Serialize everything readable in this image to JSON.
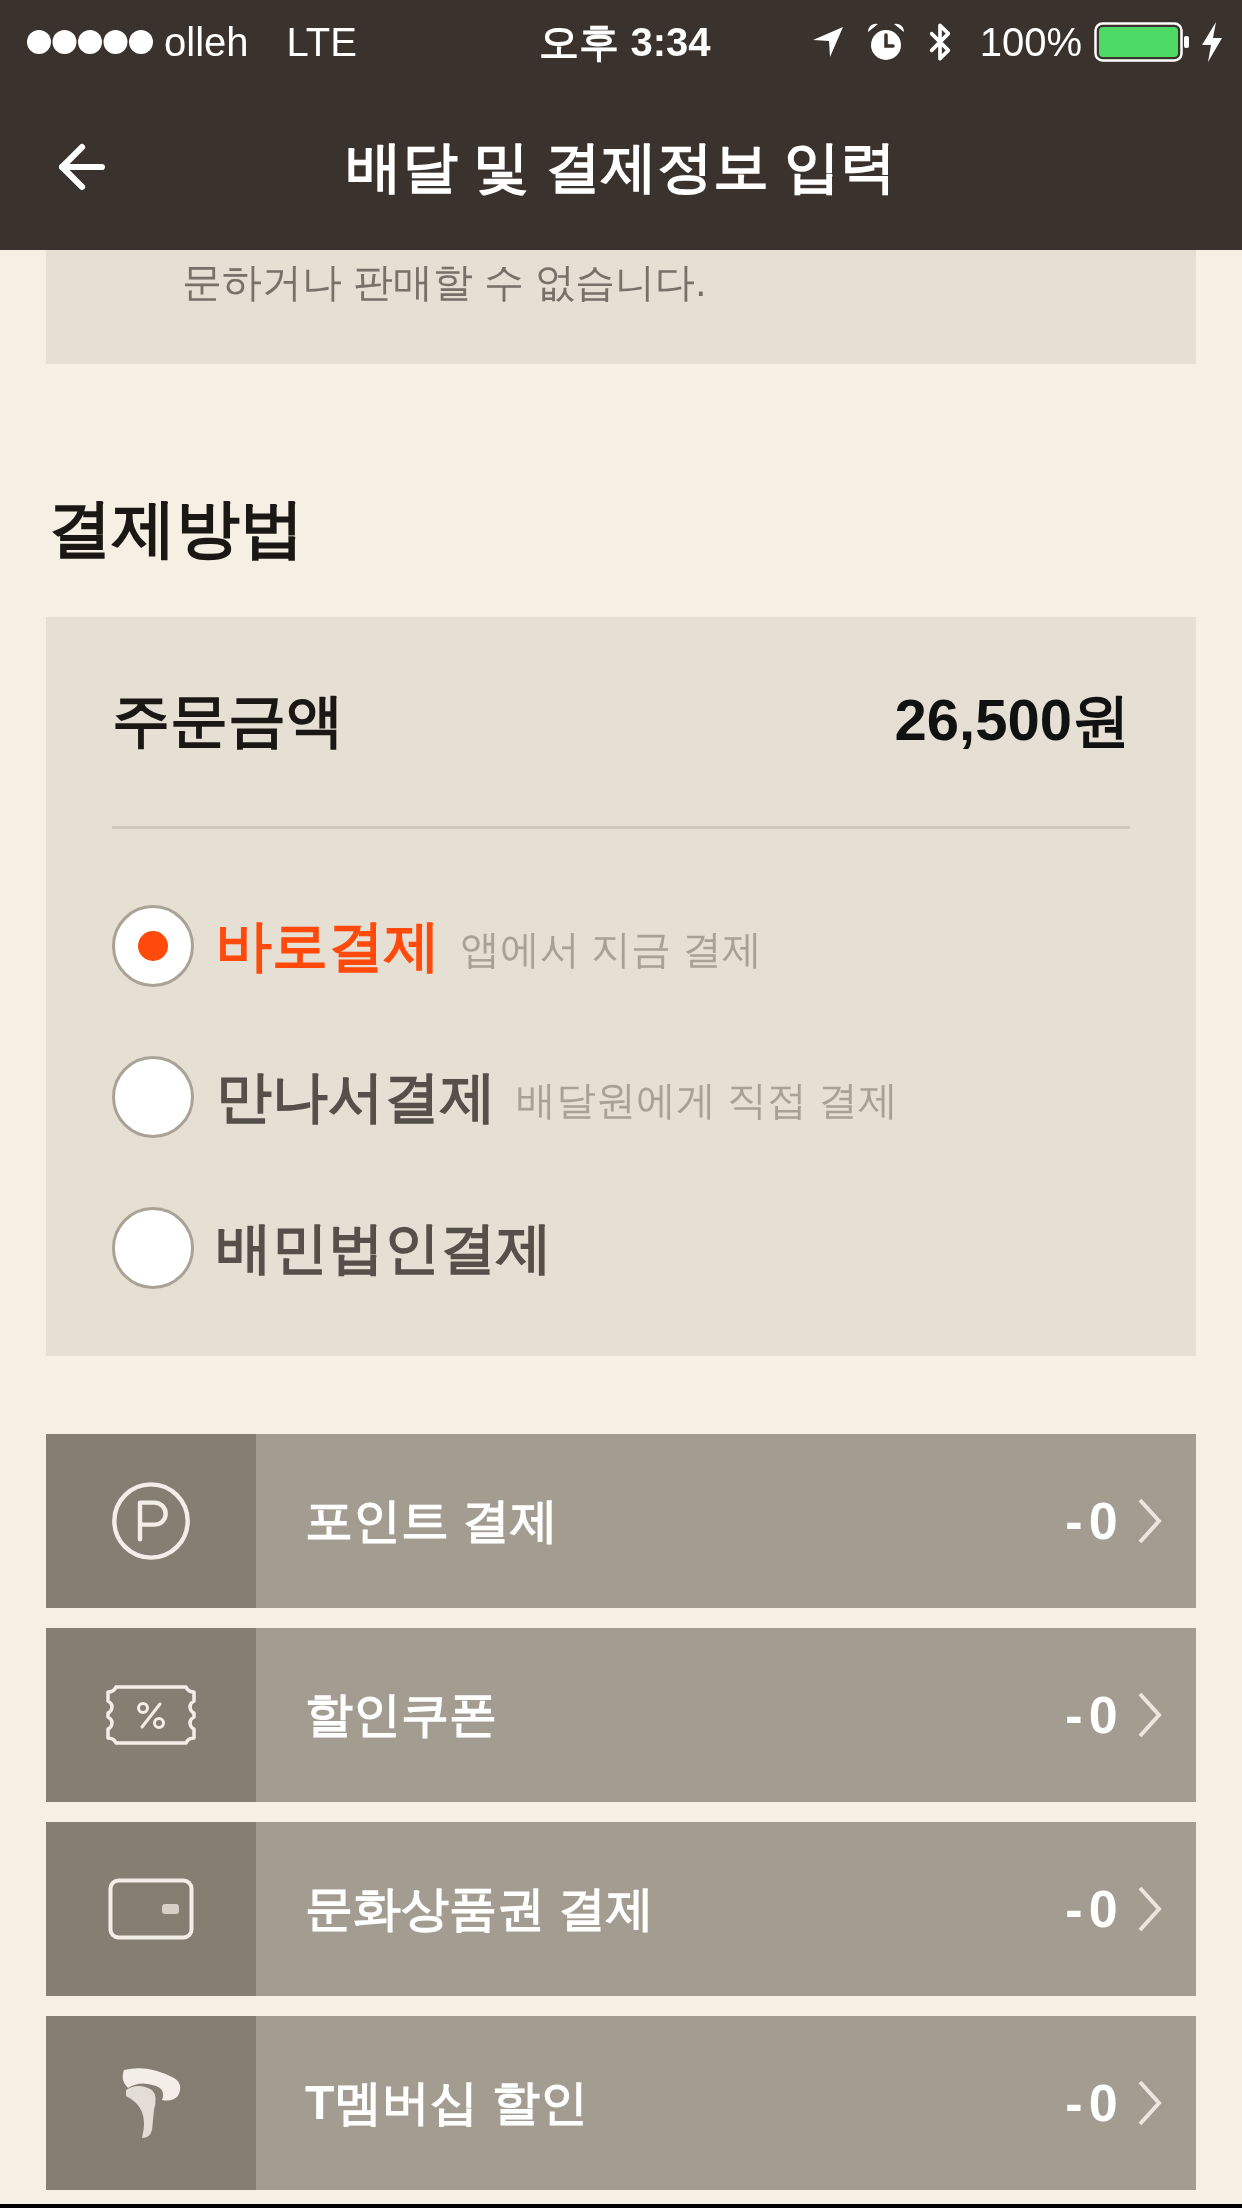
{
  "status_bar": {
    "carrier": "olleh",
    "network": "LTE",
    "time": "오후 3:34",
    "battery": "100%"
  },
  "header": {
    "title": "배달 및 결제정보 입력"
  },
  "notice": {
    "text": "문하거나 판매할 수 없습니다."
  },
  "payment": {
    "heading": "결제방법",
    "order_amount": {
      "label": "주문금액",
      "value": "26,500원"
    },
    "methods": [
      {
        "label": "바로결제",
        "description": "앱에서 지금 결제",
        "selected": true
      },
      {
        "label": "만나서결제",
        "description": "배달원에게 직접 결제",
        "selected": false
      },
      {
        "label": "배민법인결제",
        "selected": false
      }
    ]
  },
  "discounts": [
    {
      "kind": "point",
      "label": "포인트 결제",
      "value": "-0"
    },
    {
      "kind": "coupon",
      "label": "할인쿠폰",
      "value": "-0"
    },
    {
      "kind": "gift_card",
      "label": "문화상품권 결제",
      "value": "-0"
    },
    {
      "kind": "membership",
      "label": "T멤버십 할인",
      "value": "-0"
    }
  ]
}
